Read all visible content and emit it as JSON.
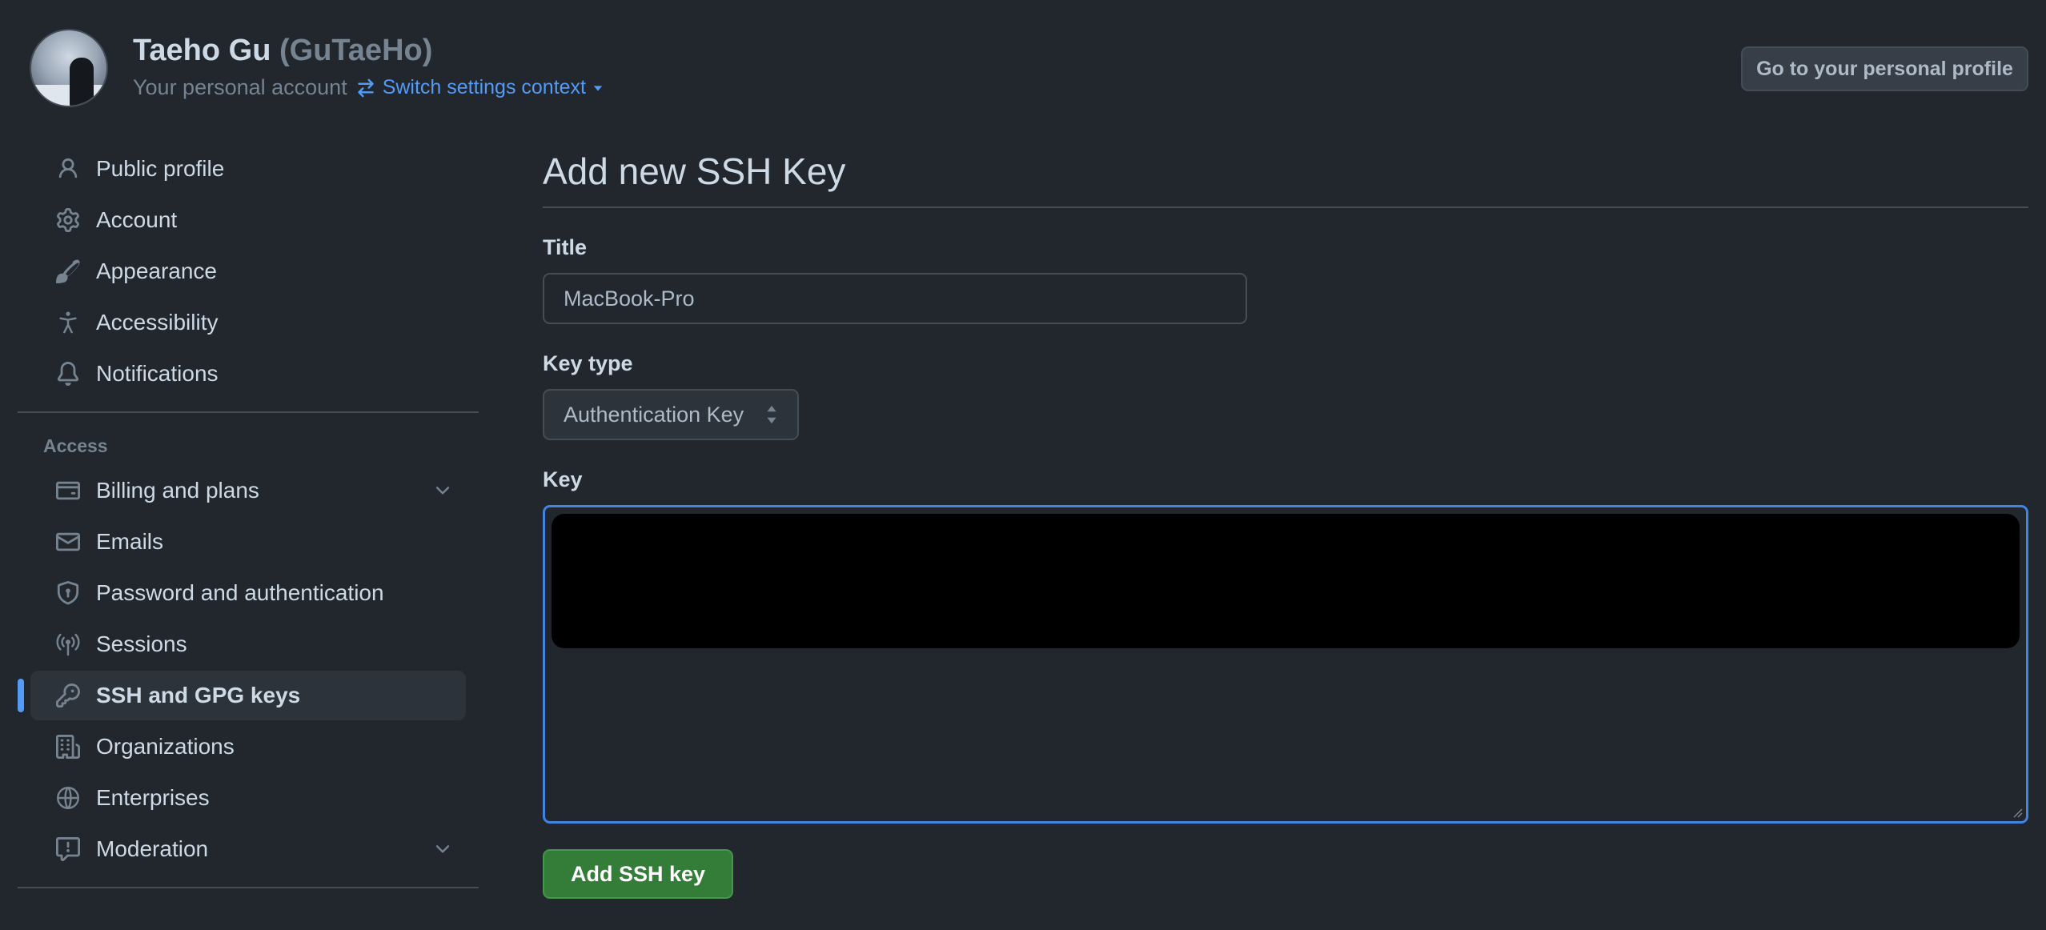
{
  "header": {
    "display_name": "Taeho Gu",
    "login": "(GuTaeHo)",
    "subtitle": "Your personal account",
    "switch_context": "Switch settings context",
    "profile_button": "Go to your personal profile"
  },
  "sidebar": {
    "items": [
      {
        "label": "Public profile",
        "icon": "person-icon"
      },
      {
        "label": "Account",
        "icon": "gear-icon"
      },
      {
        "label": "Appearance",
        "icon": "paintbrush-icon"
      },
      {
        "label": "Accessibility",
        "icon": "accessibility-icon"
      },
      {
        "label": "Notifications",
        "icon": "bell-icon"
      }
    ],
    "access_label": "Access",
    "access_items": [
      {
        "label": "Billing and plans",
        "icon": "credit-card-icon",
        "expandable": true
      },
      {
        "label": "Emails",
        "icon": "mail-icon"
      },
      {
        "label": "Password and authentication",
        "icon": "shield-icon"
      },
      {
        "label": "Sessions",
        "icon": "broadcast-icon"
      },
      {
        "label": "SSH and GPG keys",
        "icon": "key-icon",
        "active": true
      },
      {
        "label": "Organizations",
        "icon": "organization-icon"
      },
      {
        "label": "Enterprises",
        "icon": "globe-icon"
      },
      {
        "label": "Moderation",
        "icon": "report-icon",
        "expandable": true
      }
    ]
  },
  "main": {
    "title": "Add new SSH Key",
    "title_label": "Title",
    "title_value": "MacBook-Pro",
    "key_type_label": "Key type",
    "key_type_value": "Authentication Key",
    "key_label": "Key",
    "submit_label": "Add SSH key"
  },
  "colors": {
    "background": "#22272e",
    "accent": "#539bf5",
    "button_green": "#347d39",
    "focus_border": "#4184e4"
  }
}
